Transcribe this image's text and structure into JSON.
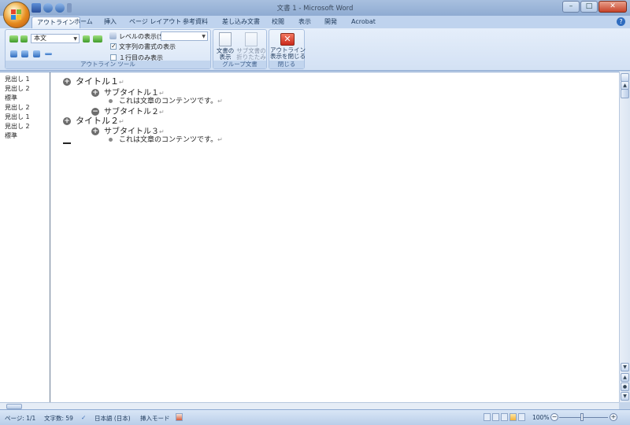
{
  "window": {
    "title": "文書 1 - Microsoft Word"
  },
  "tabs": [
    {
      "label": "アウトライン",
      "active": true
    },
    {
      "label": "ホーム"
    },
    {
      "label": "挿入"
    },
    {
      "label": "ページ レイアウト"
    },
    {
      "label": "参考資料"
    },
    {
      "label": "差し込み文書"
    },
    {
      "label": "校閲"
    },
    {
      "label": "表示"
    },
    {
      "label": "開発"
    },
    {
      "label": "Acrobat"
    }
  ],
  "ribbon": {
    "outline_tools": {
      "group_label": "アウトライン ツール",
      "level_value": "本文",
      "show_level_label": "レベルの表示(S):",
      "show_format_label": "文字列の書式の表示",
      "show_format_checked": true,
      "first_line_label": "１行目のみ表示",
      "first_line_checked": false
    },
    "master_document": {
      "group_label": "グループ文書",
      "show_document": "文書の\n表示",
      "collapse_subdocs": "サブ文書の\n折りたたみ"
    },
    "close": {
      "group_label": "閉じる",
      "close_outline": "アウトライン\n表示を閉じる"
    }
  },
  "styles_pane": [
    "見出し 1",
    "見出し 2",
    "標準",
    "見出し 2",
    "見出し 1",
    "見出し 2",
    "標準"
  ],
  "outline": [
    {
      "level": 1,
      "marker": "plus",
      "text": "タイトル１"
    },
    {
      "level": 2,
      "marker": "plus",
      "text": "サブタイトル１"
    },
    {
      "level": 3,
      "marker": "dot",
      "text": "これは文章のコンテンツです。"
    },
    {
      "level": 2,
      "marker": "minus",
      "text": "サブタイトル２"
    },
    {
      "level": 1,
      "marker": "plus",
      "text": "タイトル２"
    },
    {
      "level": 2,
      "marker": "plus",
      "text": "サブタイトル３"
    },
    {
      "level": 3,
      "marker": "dot",
      "text": "これは文章のコンテンツです。"
    }
  ],
  "paragraph_mark": "↵",
  "status": {
    "page": "ページ: 1/1",
    "word_count": "文字数: 59",
    "language": "日本語 (日本)",
    "mode": "挿入モード",
    "zoom": "100%"
  }
}
